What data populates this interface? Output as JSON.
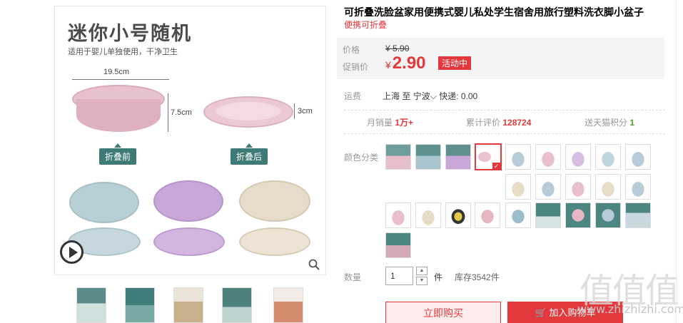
{
  "gallery": {
    "image_title": "迷你小号随机",
    "image_subtitle": "适用于婴儿单独使用，干净卫生",
    "dim_width": "19.5cm",
    "dim_height": "7.5cm",
    "dim_folded": "3cm",
    "tag_before": "折叠前",
    "tag_after": "折叠后",
    "thumb_count": 5
  },
  "product": {
    "title": "可折叠洗脸盆家用便携式婴儿私处学生宿舍用旅行塑料洗衣脚小盆子",
    "subtitle": "便携可折叠"
  },
  "price": {
    "orig_label": "价格",
    "orig_currency": "¥",
    "orig_value": "5.90",
    "promo_label": "促销价",
    "promo_currency": "¥",
    "promo_value": "2.90",
    "promo_badge": "活动中",
    "accent": "#e4393c"
  },
  "shipping": {
    "label": "运费",
    "from": "上海",
    "to_word": "至",
    "to": "宁波",
    "express": "快递: 0.00"
  },
  "stats": {
    "monthly_label": "月销量",
    "monthly_value": "1万+",
    "reviews_label": "累计评价",
    "reviews_value": "128724",
    "points_label": "送天猫积分",
    "points_value": "1"
  },
  "color": {
    "label": "颜色分类"
  },
  "quantity": {
    "label": "数量",
    "value": "1",
    "unit": "件",
    "stock": "库存3542件"
  },
  "actions": {
    "buy_now": "立即购买",
    "add_cart": "加入购物车"
  },
  "watermark": {
    "chars": "值值值",
    "url": "www.zhizhizhi.com"
  }
}
